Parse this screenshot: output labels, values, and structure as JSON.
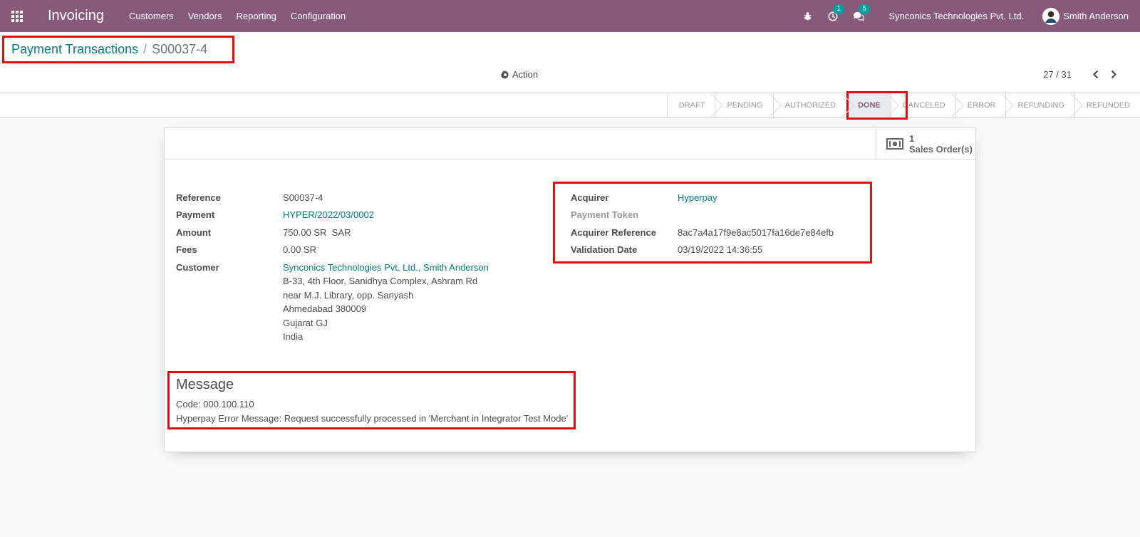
{
  "navbar": {
    "app_title": "Invoicing",
    "menu": [
      "Customers",
      "Vendors",
      "Reporting",
      "Configuration"
    ],
    "activity_count": "1",
    "message_count": "5",
    "company": "Synconics Technologies Pvt. Ltd.",
    "user": "Smith Anderson",
    "bg_color": "#875a7b"
  },
  "breadcrumb": {
    "parent": "Payment Transactions",
    "separator": "/",
    "current": "S00037-4"
  },
  "control": {
    "action_label": "Action",
    "pager_value": "27 / 31"
  },
  "status": {
    "stages": [
      "DRAFT",
      "PENDING",
      "AUTHORIZED",
      "DONE",
      "CANCELED",
      "ERROR",
      "REFUNDING",
      "REFUNDED"
    ],
    "active": "DONE"
  },
  "smart_button": {
    "value": "1",
    "label": "Sales Order(s)"
  },
  "left_fields": {
    "reference_label": "Reference",
    "reference_value": "S00037-4",
    "payment_label": "Payment",
    "payment_value": "HYPER/2022/03/0002",
    "amount_label": "Amount",
    "amount_value": "750.00 SR  SAR",
    "fees_label": "Fees",
    "fees_value": "0.00 SR",
    "customer_label": "Customer",
    "customer_name": "Synconics Technologies Pvt. Ltd., Smith Anderson",
    "customer_address": [
      "B-33, 4th Floor, Sanidhya Complex, Ashram Rd",
      "near M.J. Library, opp. Sanyash",
      "Ahmedabad 380009",
      "Gujarat GJ",
      "India"
    ]
  },
  "right_fields": {
    "acquirer_label": "Acquirer",
    "acquirer_value": "Hyperpay",
    "token_label": "Payment Token",
    "acq_ref_label": "Acquirer Reference",
    "acq_ref_value": "8ac7a4a17f9e8ac5017fa16de7e84efb",
    "validation_label": "Validation Date",
    "validation_value": "03/19/2022 14:36:55"
  },
  "message": {
    "title": "Message",
    "code_line": "Code: 000.100.110",
    "error_line": "Hyperpay Error Message: Request successfully processed in 'Merchant in Integrator Test Mode'"
  },
  "colors": {
    "accent_link": "#017e84",
    "highlight": "#ee0a0a"
  }
}
